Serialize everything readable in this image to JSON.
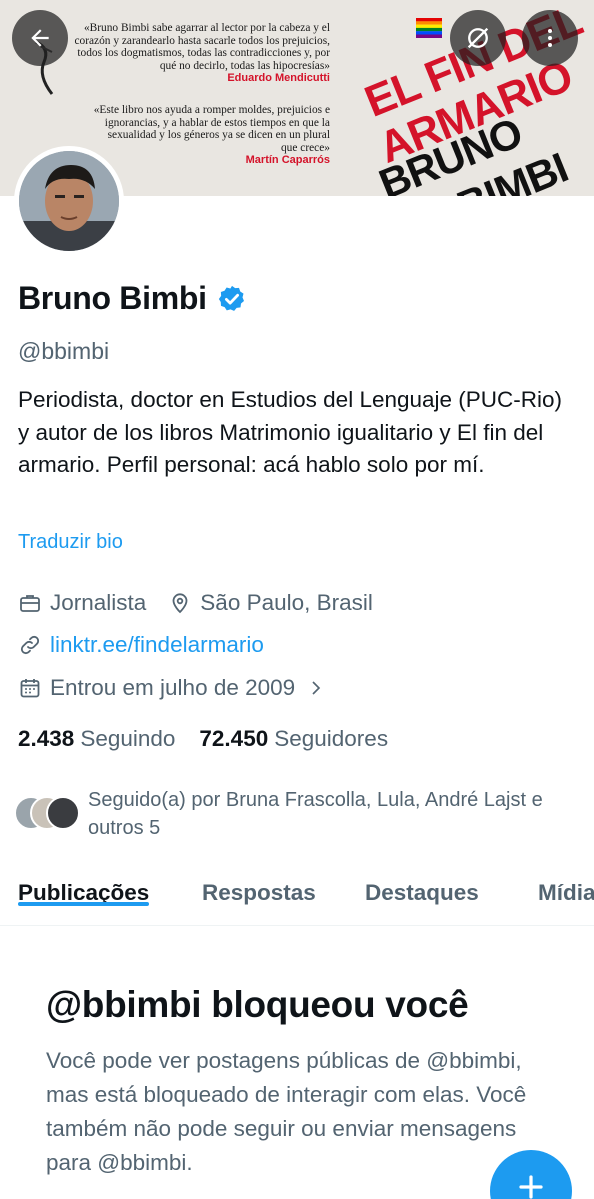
{
  "banner": {
    "quote1": "«Bruno Bimbi sabe agarrar al lector por la cabeza y el corazón y zarandearlo hasta sacarle todos los prejuicios, todos los dogmatismos, todas las contradicciones y, por qué no decirlo, todas las hipocresías»",
    "quote1_author": "Eduardo Mendicutti",
    "quote2": "«Este libro nos ayuda a romper moldes, prejuicios e ignorancias, y a hablar de estos tiempos en que la sexualidad y los géneros ya se dicen en un plural que crece»",
    "quote2_author": "Martín Caparrós",
    "book_title_line1": "EL FIN DEL",
    "book_title_line2": "ARMARIO",
    "book_author_line1": "BRUNO",
    "book_author_line2": "BIMBI"
  },
  "profile": {
    "name": "Bruno Bimbi",
    "handle": "@bbimbi",
    "bio": "Periodista, doctor en Estudios del Lenguaje (PUC-Rio) y autor de los libros Matrimonio igualitario y El fin del armario. Perfil personal: acá hablo solo por mí.",
    "translate_label": "Traduzir bio",
    "profession": "Jornalista",
    "location": "São Paulo, Brasil",
    "link": "linktr.ee/findelarmario",
    "joined": "Entrou em julho de 2009",
    "following_count": "2.438",
    "following_label": "Seguindo",
    "followers_count": "72.450",
    "followers_label": "Seguidores",
    "followed_by": "Seguido(a) por Bruna Frascolla, Lula, André Lajst e outros 5"
  },
  "tabs": [
    {
      "label": "Publicações",
      "active": true
    },
    {
      "label": "Respostas",
      "active": false
    },
    {
      "label": "Destaques",
      "active": false
    },
    {
      "label": "Mídia",
      "active": false
    }
  ],
  "blocked": {
    "title": "@bbimbi bloqueou você",
    "message": "Você pode ver postagens públicas de @bbimbi, mas está bloqueado de interagir com elas. Você também não pode seguir ou enviar mensagens para @bbimbi."
  },
  "icons": {
    "back": "arrow-left-icon",
    "nosync": "no-sync-icon",
    "more": "more-vertical-icon",
    "verified": "verified-badge-icon",
    "profession": "briefcase-icon",
    "location": "location-pin-icon",
    "link": "link-icon",
    "calendar": "calendar-icon",
    "fab": "plus-icon"
  },
  "colors": {
    "accent": "#1d9bf0",
    "text_primary": "#0f1419",
    "text_secondary": "#536471",
    "banner_red": "#d4132a"
  }
}
